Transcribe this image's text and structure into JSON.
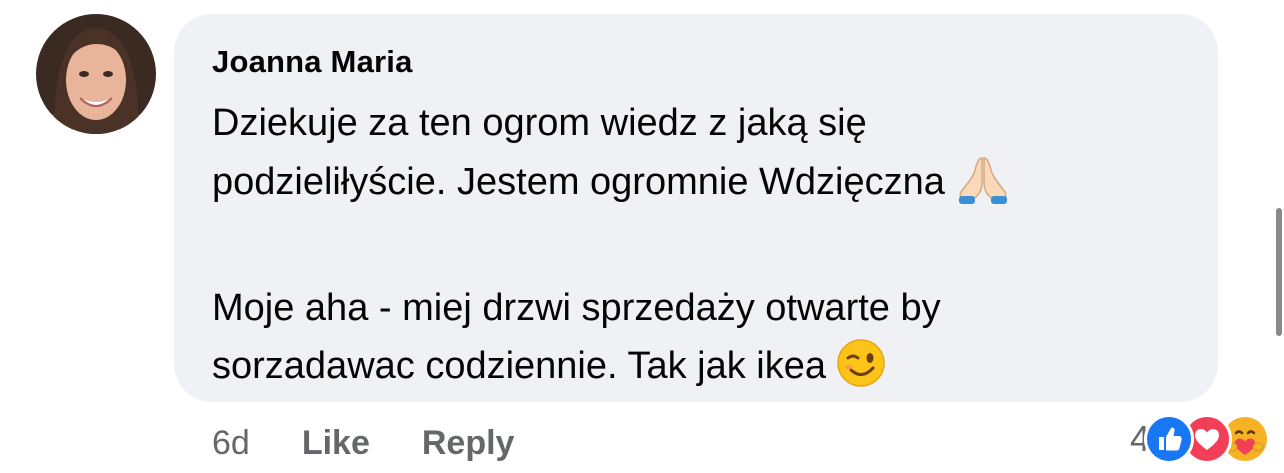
{
  "comment": {
    "author": "Joanna Maria",
    "lines": [
      "Dziekuje za ten ogrom wiedz z jaką się",
      "podzieliłyście. Jestem ogromnie Wdzięczna",
      "Moje aha - miej drzwi sprzedaży otwarte by",
      "sorzadawac codziennie. Tak jak ikea"
    ],
    "emojis": [
      "folded-hands-emoji",
      "winking-face-emoji"
    ],
    "timestamp": "6d",
    "actions": {
      "like": "Like",
      "reply": "Reply"
    },
    "reactions": {
      "count": "4",
      "types": [
        "like",
        "love",
        "care"
      ]
    }
  },
  "colors": {
    "bubble": "#eff1f4",
    "secondary_text": "#65676b",
    "like_blue": "#1877f2",
    "love_red": "#f33e58",
    "care_yellow": "#f7b125"
  }
}
